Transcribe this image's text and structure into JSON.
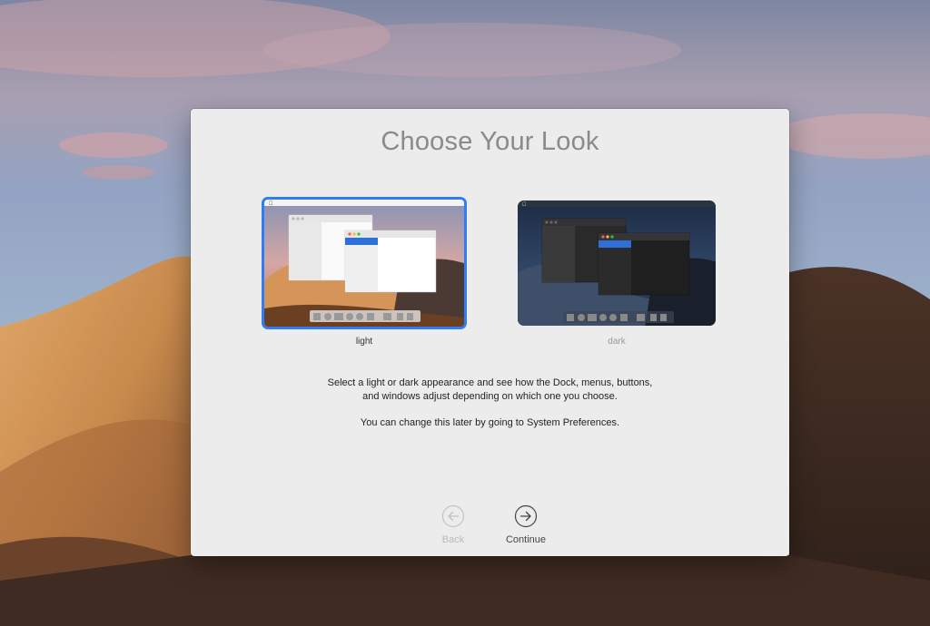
{
  "dialog": {
    "title": "Choose Your Look",
    "options": [
      {
        "label": "light",
        "selected": true
      },
      {
        "label": "dark",
        "selected": false
      }
    ],
    "description": [
      "Select a light or dark appearance and see how the Dock, menus, buttons,",
      "and windows adjust depending on which one you choose.",
      "You can change this later by going to System Preferences."
    ],
    "buttons": {
      "back_label": "Back",
      "continue_label": "Continue"
    }
  },
  "colors": {
    "accent": "#2f7cf6",
    "dialog_bg": "#ececec",
    "title": "#8a8a8a"
  },
  "icons": {
    "back": "arrow-left-circle",
    "continue": "arrow-right-circle",
    "apple": "apple-logo"
  }
}
